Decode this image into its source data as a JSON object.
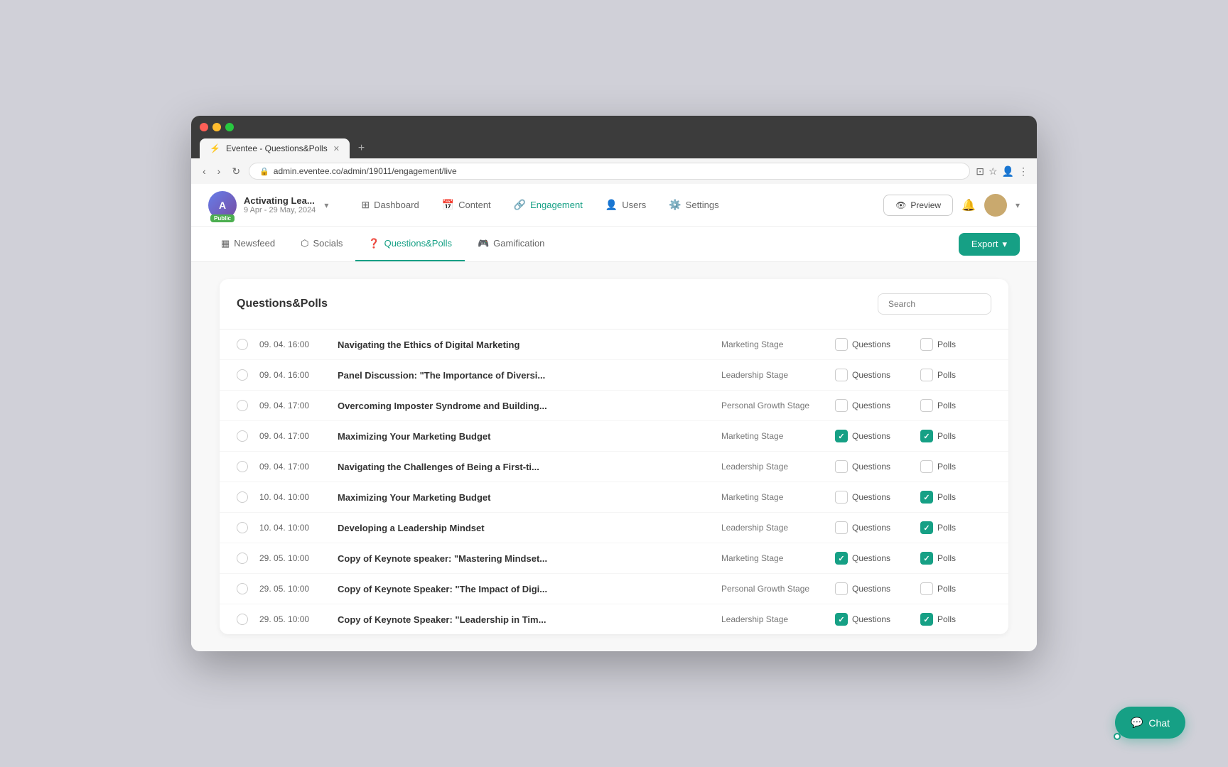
{
  "browser": {
    "tab_title": "Eventee - Questions&Polls",
    "address": "admin.eventee.co/admin/19011/engagement/live",
    "new_tab_icon": "+"
  },
  "top_nav": {
    "brand_name": "Activating Lea...",
    "brand_date": "9 Apr - 29 May, 2024",
    "public_badge": "Public",
    "nav_items": [
      {
        "label": "Dashboard",
        "icon": "⊞",
        "active": false
      },
      {
        "label": "Content",
        "icon": "📅",
        "active": false
      },
      {
        "label": "Engagement",
        "icon": "🔗",
        "active": true
      },
      {
        "label": "Users",
        "icon": "👤",
        "active": false
      },
      {
        "label": "Settings",
        "icon": "⚙️",
        "active": false
      }
    ],
    "preview_btn": "Preview",
    "dropdown_arrow": "▾"
  },
  "sub_nav": {
    "items": [
      {
        "label": "Newsfeed",
        "icon": "▦",
        "active": false
      },
      {
        "label": "Socials",
        "icon": "⬡",
        "active": false
      },
      {
        "label": "Questions&Polls",
        "icon": "❓",
        "active": true
      },
      {
        "label": "Gamification",
        "icon": "🎮",
        "active": false
      }
    ],
    "export_btn": "Export"
  },
  "content": {
    "title": "Questions&Polls",
    "search_placeholder": "Search",
    "rows": [
      {
        "date": "09. 04. 16:00",
        "title": "Navigating the Ethics of Digital Marketing",
        "stage": "Marketing Stage",
        "questions_checked": false,
        "polls_checked": false
      },
      {
        "date": "09. 04. 16:00",
        "title": "Panel Discussion: \"The Importance of Diversi...",
        "stage": "Leadership Stage",
        "questions_checked": false,
        "polls_checked": false
      },
      {
        "date": "09. 04. 17:00",
        "title": "Overcoming Imposter Syndrome and Building...",
        "stage": "Personal Growth Stage",
        "questions_checked": false,
        "polls_checked": false
      },
      {
        "date": "09. 04. 17:00",
        "title": "Maximizing Your Marketing Budget",
        "stage": "Marketing Stage",
        "questions_checked": true,
        "polls_checked": true
      },
      {
        "date": "09. 04. 17:00",
        "title": "Navigating the Challenges of Being a First-ti...",
        "stage": "Leadership Stage",
        "questions_checked": false,
        "polls_checked": false
      },
      {
        "date": "10. 04. 10:00",
        "title": "Maximizing Your Marketing Budget",
        "stage": "Marketing Stage",
        "questions_checked": false,
        "polls_checked": true
      },
      {
        "date": "10. 04. 10:00",
        "title": "Developing a Leadership Mindset",
        "stage": "Leadership Stage",
        "questions_checked": false,
        "polls_checked": true
      },
      {
        "date": "29. 05. 10:00",
        "title": "Copy of Keynote speaker: \"Mastering Mindset...",
        "stage": "Marketing Stage",
        "questions_checked": true,
        "polls_checked": true
      },
      {
        "date": "29. 05. 10:00",
        "title": "Copy of Keynote Speaker: \"The Impact of Digi...",
        "stage": "Personal Growth Stage",
        "questions_checked": false,
        "polls_checked": false
      },
      {
        "date": "29. 05. 10:00",
        "title": "Copy of Keynote Speaker: \"Leadership in Tim...",
        "stage": "Leadership Stage",
        "questions_checked": true,
        "polls_checked": true
      }
    ]
  },
  "chat": {
    "label": "Chat"
  },
  "labels": {
    "questions": "Questions",
    "polls": "Polls"
  }
}
